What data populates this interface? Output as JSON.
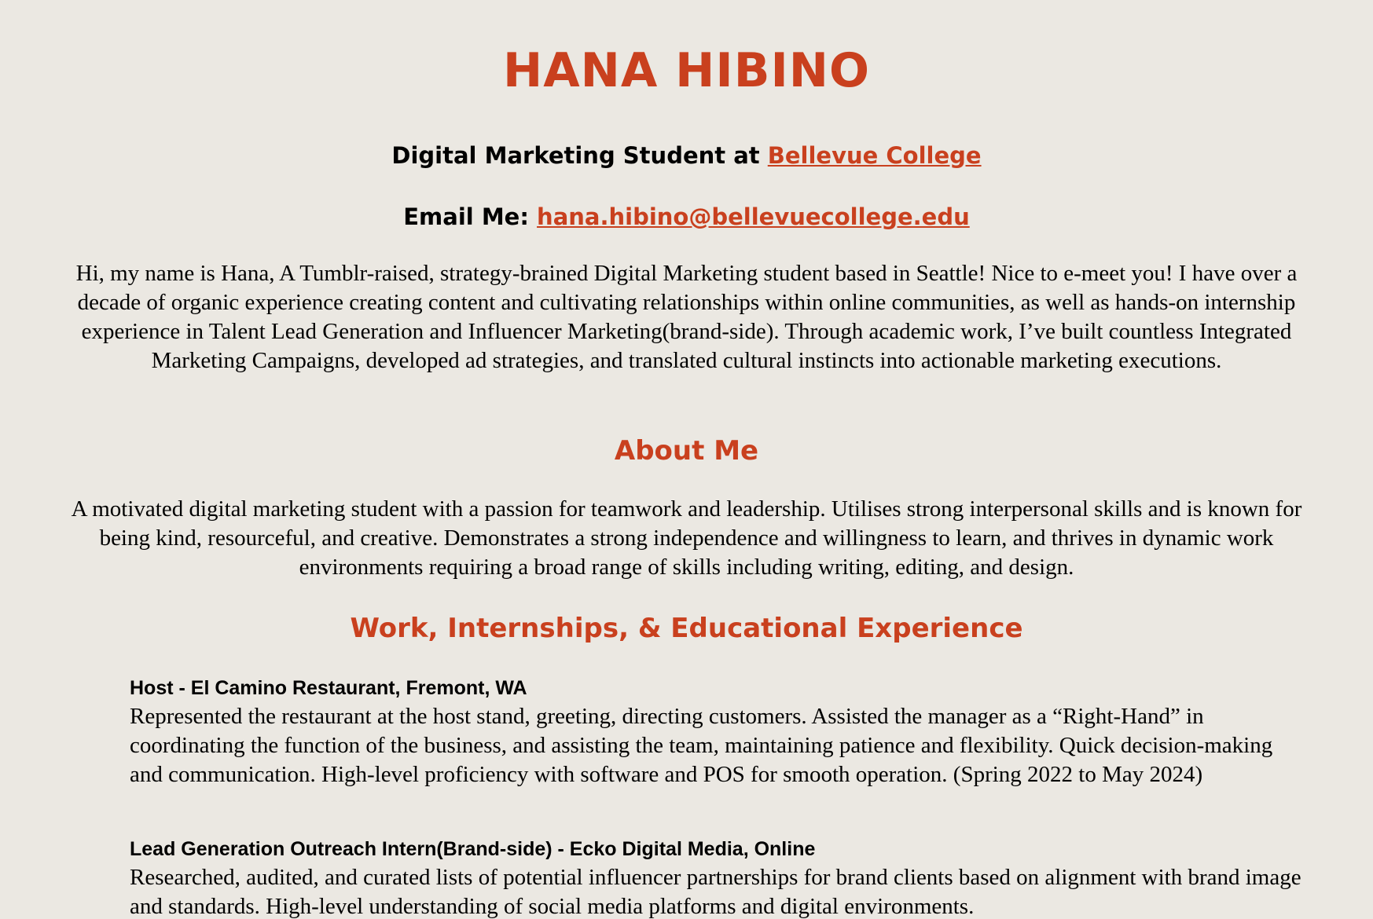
{
  "header": {
    "name": "HANA HIBINO",
    "tagline_prefix": "Digital Marketing Student at ",
    "tagline_link": "Bellevue College",
    "email_label": "Email Me: ",
    "email_link": "hana.hibino@bellevuecollege.edu"
  },
  "intro": "Hi, my name is Hana, A Tumblr-raised, strategy-brained Digital Marketing student based in Seattle! Nice to e-meet you! I have over a decade of organic experience creating content and cultivating relationships within online communities, as well as hands-on internship experience in Talent Lead Generation and Influencer Marketing(brand-side). Through academic work, I’ve built countless Integrated Marketing Campaigns, developed ad strategies, and translated cultural instincts into actionable marketing executions.",
  "about": {
    "heading": "About Me",
    "text": "A motivated digital marketing student with a passion for teamwork and leadership. Utilises strong interpersonal skills and is known for being kind, resourceful, and creative. Demonstrates a strong independence and willingness to learn, and thrives in dynamic work environments requiring a broad range of skills including writing, editing, and design."
  },
  "experience": {
    "heading": "Work, Internships, & Educational Experience",
    "jobs": [
      {
        "title": "Host - El Camino Restaurant, Fremont, WA",
        "description": "Represented the restaurant at the host stand, greeting, directing customers. Assisted the manager as a “Right-Hand” in coordinating the function of the business, and assisting the team, maintaining patience and flexibility. Quick decision-making and communication. High-level proficiency with software and POS for smooth operation. (Spring 2022 to May 2024)"
      },
      {
        "title": "Lead Generation Outreach Intern(Brand-side) - Ecko Digital Media, Online",
        "description": "Researched, audited, and curated lists of potential influencer partnerships for brand clients based on alignment with brand image and standards. High-level understanding of social media platforms and digital environments."
      }
    ]
  },
  "colors": {
    "accent": "#c9401e",
    "background": "#ebe8e2",
    "text": "#000000"
  }
}
